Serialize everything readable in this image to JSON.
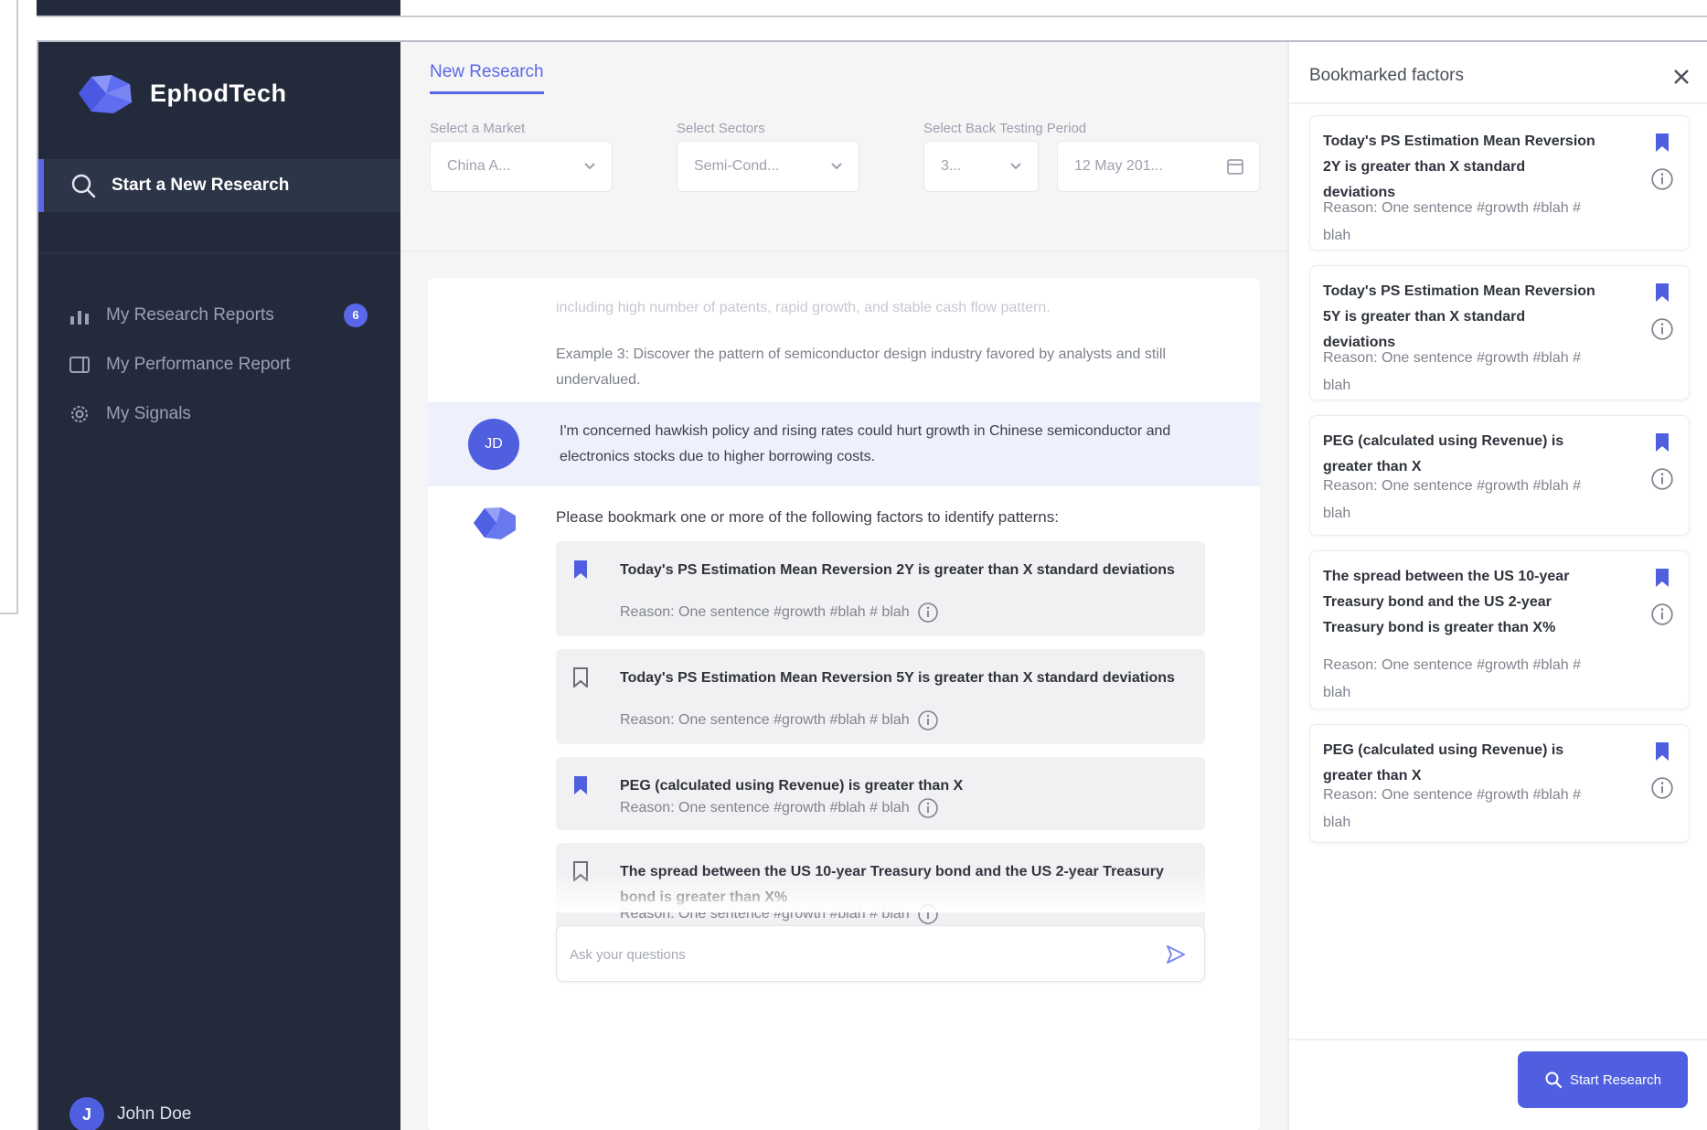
{
  "brand": {
    "name": "EphodTech",
    "accent": "#5a67e8",
    "sidebar_bg": "#232a3b"
  },
  "sidebar": {
    "new_research": "Start a New Research",
    "items": [
      {
        "label": "My Research Reports",
        "icon": "bar-chart-icon",
        "badge": "6"
      },
      {
        "label": "My Performance Report",
        "icon": "report-icon"
      },
      {
        "label": "My Signals",
        "icon": "gear-icon"
      }
    ],
    "user": {
      "initial": "J",
      "name": "John Doe"
    }
  },
  "main": {
    "tab": "New Research",
    "filters": {
      "market": {
        "label": "Select a Market",
        "value": "China A..."
      },
      "sectors": {
        "label": "Select Sectors",
        "value": "Semi-Cond..."
      },
      "period": {
        "label": "Select Back Testing Period",
        "value": "3...",
        "date": "12 May 201..."
      }
    },
    "chat": {
      "faded_line": "including high number of patents, rapid growth, and stable cash flow pattern.",
      "example": "Example 3: Discover the pattern of semiconductor design industry favored by analysts and still undervalued.",
      "user_avatar": "JD",
      "user_message": "I'm concerned hawkish policy and rising rates could hurt growth in Chinese semiconductor and electronics stocks due to higher borrowing costs.",
      "bot_intro": "Please bookmark one or more of the following factors to identify patterns:",
      "factors": [
        {
          "title": "Today's PS Estimation Mean Reversion 2Y is greater than X standard deviations",
          "reason": "Reason: One sentence #growth #blah # blah",
          "bookmarked": true
        },
        {
          "title": "Today's PS Estimation Mean Reversion 5Y is greater than X standard deviations",
          "reason": "Reason: One sentence #growth #blah # blah",
          "bookmarked": false
        },
        {
          "title": "PEG (calculated using Revenue) is greater than X",
          "reason": "Reason: One sentence #growth #blah # blah",
          "bookmarked": true
        },
        {
          "title": "The spread between the US 10-year Treasury bond and the US 2-year Treasury bond is greater than X%",
          "reason": "Reason: One sentence #growth #blah # blah",
          "bookmarked": false
        }
      ],
      "ask_placeholder": "Ask your questions"
    }
  },
  "panel": {
    "title": "Bookmarked factors",
    "cards": [
      {
        "title": "Today's PS Estimation Mean Reversion 2Y is greater than X standard deviations",
        "reason": "Reason: One sentence #growth #blah # blah"
      },
      {
        "title": "Today's PS Estimation Mean Reversion 5Y is greater than X standard deviations",
        "reason": "Reason: One sentence #growth #blah # blah"
      },
      {
        "title": "PEG (calculated using Revenue) is greater than X",
        "reason": "Reason: One sentence #growth #blah # blah"
      },
      {
        "title": "The spread between the US 10-year Treasury bond and the US 2-year Treasury bond is greater than X%",
        "reason": "Reason: One sentence #growth #blah # blah"
      },
      {
        "title": "PEG (calculated using Revenue) is greater than X",
        "reason": "Reason: One sentence #growth #blah # blah"
      }
    ],
    "start_button": "Start Research"
  }
}
